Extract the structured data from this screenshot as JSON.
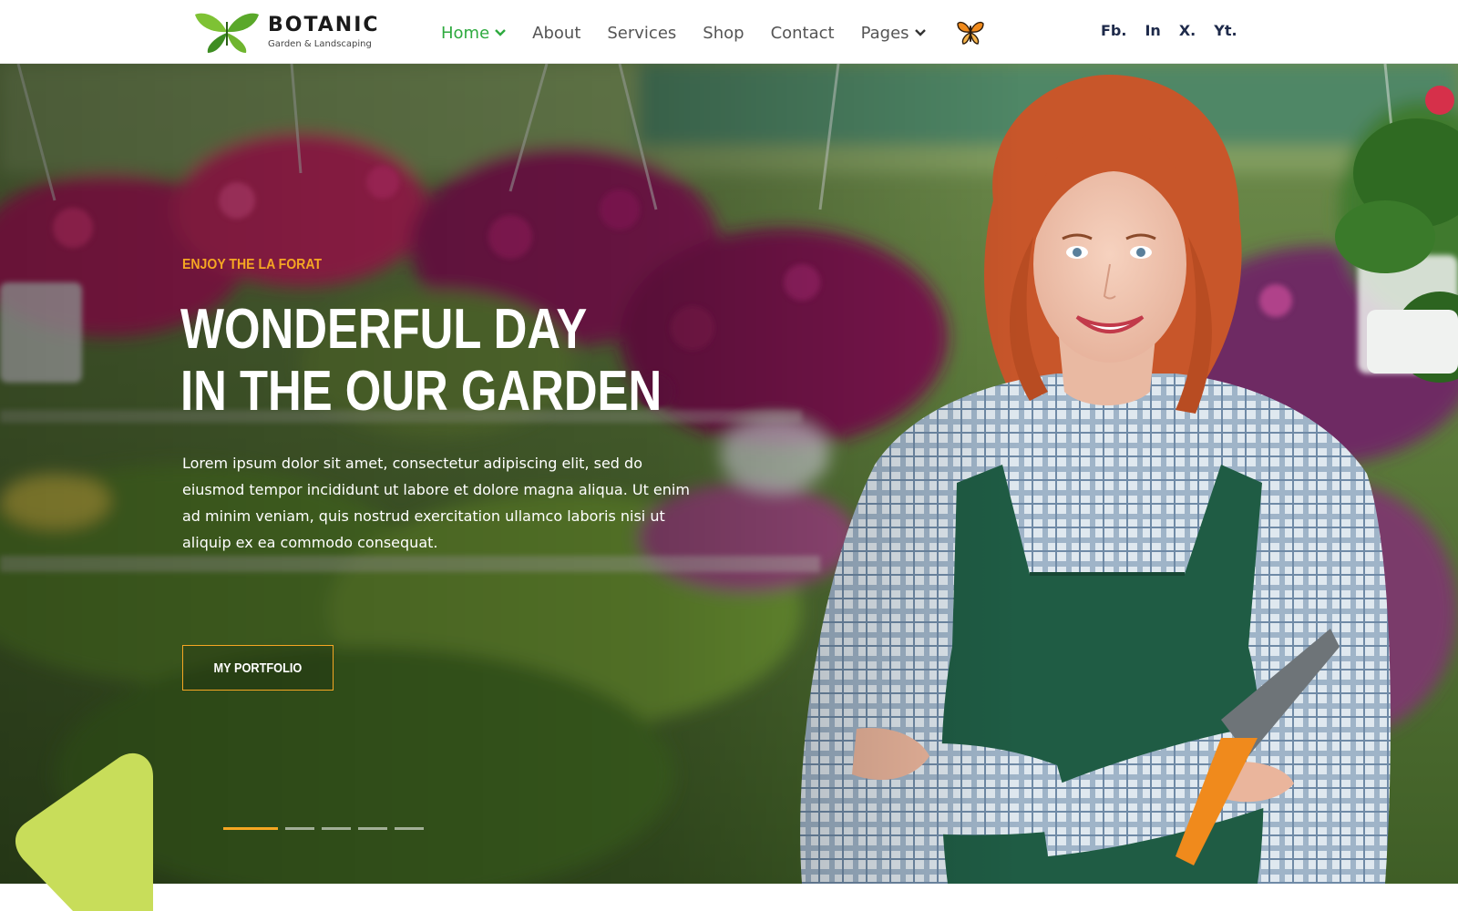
{
  "brand": {
    "name": "BOTANIC",
    "tagline": "Garden & Landscaping"
  },
  "nav": {
    "items": [
      {
        "label": "Home",
        "active": true,
        "has_dropdown": true
      },
      {
        "label": "About"
      },
      {
        "label": "Services"
      },
      {
        "label": "Shop"
      },
      {
        "label": "Contact"
      },
      {
        "label": "Pages",
        "has_dropdown": true
      }
    ],
    "icon": "butterfly-icon"
  },
  "social": {
    "links": [
      "Fb.",
      "In",
      "X.",
      "Yt."
    ]
  },
  "hero": {
    "eyebrow": "ENJOY THE LA FORAT",
    "headline_line1": "WONDERFUL DAY",
    "headline_line2": "IN THE OUR GARDEN",
    "description": "Lorem ipsum dolor sit amet, consectetur adipiscing elit, sed do eiusmod tempor incididunt ut labore et dolore magna aliqua. Ut enim ad minim veniam, quis nostrud exercitation ullamco laboris nisi ut aliquip ex ea commodo consequat.",
    "button_label": "MY PORTFOLIO",
    "slide_count": 5,
    "active_slide": 1
  },
  "colors": {
    "accent_green": "#2eaa3f",
    "accent_orange": "#f5a623",
    "deco_lime": "#c8dd5a",
    "social_navy": "#1e2a4a"
  }
}
